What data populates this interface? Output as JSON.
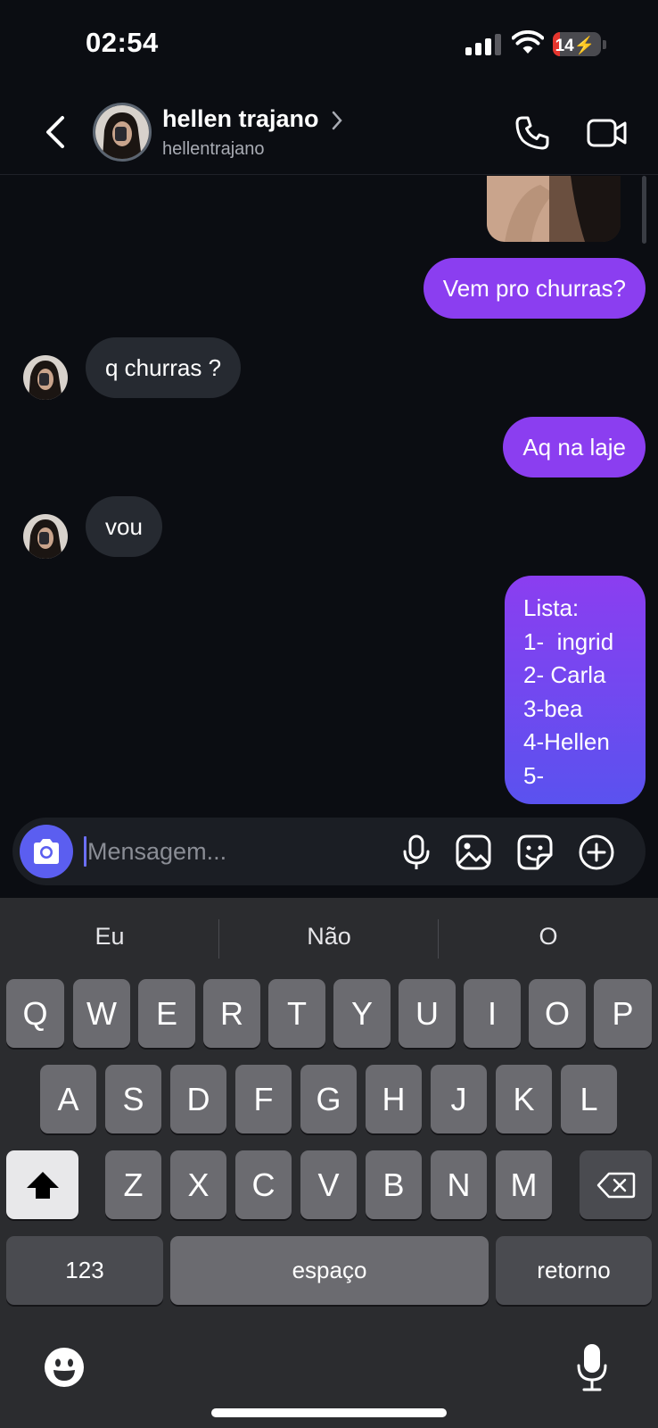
{
  "status_bar": {
    "time": "02:54",
    "battery": "14"
  },
  "header": {
    "name": "hellen trajano",
    "handle": "hellentrajano",
    "icons": [
      "back-icon",
      "chevron-right-icon",
      "phone-icon",
      "video-icon"
    ]
  },
  "messages": [
    {
      "side": "sent",
      "type": "image"
    },
    {
      "side": "sent",
      "text": "Vem pro churras?"
    },
    {
      "side": "received",
      "text": "q churras ?"
    },
    {
      "side": "sent",
      "text": "Aq na laje"
    },
    {
      "side": "received",
      "text": "vou"
    },
    {
      "side": "sent",
      "lines": [
        "Lista:",
        "1-  ingrid",
        "2- Carla",
        "3-bea",
        "4-Hellen",
        "5-"
      ]
    }
  ],
  "composer": {
    "placeholder": "Mensagem...",
    "icons": [
      "camera-icon",
      "microphone-icon",
      "gallery-icon",
      "sticker-icon",
      "plus-circle-icon"
    ]
  },
  "keyboard": {
    "suggestions": [
      "Eu",
      "Não",
      "O"
    ],
    "row1": [
      "Q",
      "W",
      "E",
      "R",
      "T",
      "Y",
      "U",
      "I",
      "O",
      "P"
    ],
    "row2": [
      "A",
      "S",
      "D",
      "F",
      "G",
      "H",
      "J",
      "K",
      "L"
    ],
    "row3": [
      "Z",
      "X",
      "C",
      "V",
      "B",
      "N",
      "M"
    ],
    "numbers": "123",
    "space": "espaço",
    "return": "retorno"
  },
  "colors": {
    "background": "#0b0d12",
    "sent_bubble": "#8b3ef0",
    "sent_bubble_gradient_end": "#5a52ef",
    "received_bubble": "#262a31",
    "camera_button": "#5b5ef0",
    "keyboard_bg": "#2b2c2f",
    "key": "#6b6b70"
  }
}
